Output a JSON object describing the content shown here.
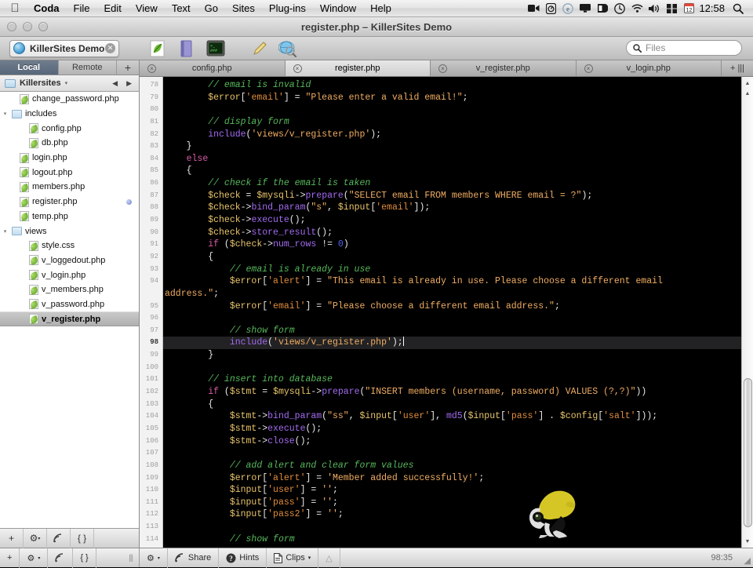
{
  "menubar": {
    "apple": "&#63743;",
    "items": [
      "Coda",
      "File",
      "Edit",
      "View",
      "Text",
      "Go",
      "Sites",
      "Plug-ins",
      "Window",
      "Help"
    ],
    "status_icons": [
      "screen-recording-icon",
      "dropbox-icon",
      "internet-explorer-icon",
      "display-icon",
      "dashboard-icon",
      "time-machine-icon",
      "wifi-icon",
      "volume-icon",
      "spaces-icon",
      "calendar-icon"
    ],
    "clock": "12:58",
    "spotlight": "search-icon"
  },
  "window": {
    "title": "register.php – KillerSites Demo",
    "traffic_lights": [
      "close",
      "minimize",
      "zoom"
    ]
  },
  "toolbar": {
    "site_tab_label": "KillerSites Demo",
    "icons": [
      "leaf-icon",
      "book-icon",
      "terminal-icon",
      "pencil-icon",
      "preview-icon"
    ],
    "search": {
      "placeholder": "Files",
      "value": ""
    }
  },
  "sidebar": {
    "tabs": [
      {
        "label": "Local",
        "active": true
      },
      {
        "label": "Remote",
        "active": false
      }
    ],
    "add_label": "+",
    "path": {
      "folder": "Killersites",
      "caret": "▾",
      "back": "◀",
      "forward": "▶"
    },
    "files": [
      {
        "name": "change_password.php",
        "type": "file",
        "indent": 1,
        "disclosure": "",
        "selected": false,
        "dot": false
      },
      {
        "name": "includes",
        "type": "folder",
        "indent": 0,
        "disclosure": "▾",
        "selected": false,
        "dot": false
      },
      {
        "name": "config.php",
        "type": "file",
        "indent": 2,
        "disclosure": "",
        "selected": false,
        "dot": false
      },
      {
        "name": "db.php",
        "type": "file",
        "indent": 2,
        "disclosure": "",
        "selected": false,
        "dot": false
      },
      {
        "name": "login.php",
        "type": "file",
        "indent": 1,
        "disclosure": "",
        "selected": false,
        "dot": false
      },
      {
        "name": "logout.php",
        "type": "file",
        "indent": 1,
        "disclosure": "",
        "selected": false,
        "dot": false
      },
      {
        "name": "members.php",
        "type": "file",
        "indent": 1,
        "disclosure": "",
        "selected": false,
        "dot": false
      },
      {
        "name": "register.php",
        "type": "file",
        "indent": 1,
        "disclosure": "",
        "selected": false,
        "dot": true
      },
      {
        "name": "temp.php",
        "type": "file",
        "indent": 1,
        "disclosure": "",
        "selected": false,
        "dot": false
      },
      {
        "name": "views",
        "type": "folder",
        "indent": 0,
        "disclosure": "▾",
        "selected": false,
        "dot": false
      },
      {
        "name": "style.css",
        "type": "file",
        "indent": 2,
        "disclosure": "",
        "selected": false,
        "dot": false
      },
      {
        "name": "v_loggedout.php",
        "type": "file",
        "indent": 2,
        "disclosure": "",
        "selected": false,
        "dot": false
      },
      {
        "name": "v_login.php",
        "type": "file",
        "indent": 2,
        "disclosure": "",
        "selected": false,
        "dot": false
      },
      {
        "name": "v_members.php",
        "type": "file",
        "indent": 2,
        "disclosure": "",
        "selected": false,
        "dot": false
      },
      {
        "name": "v_password.php",
        "type": "file",
        "indent": 2,
        "disclosure": "",
        "selected": false,
        "dot": false
      },
      {
        "name": "v_register.php",
        "type": "file",
        "indent": 2,
        "disclosure": "",
        "selected": true,
        "dot": false
      }
    ],
    "bottom_buttons": [
      "add-icon",
      "gear-icon",
      "publish-icon",
      "braces-icon"
    ]
  },
  "editor": {
    "tabs": [
      {
        "label": "config.php",
        "active": false
      },
      {
        "label": "register.php",
        "active": true
      },
      {
        "label": "v_register.php",
        "active": false
      },
      {
        "label": "v_login.php",
        "active": false
      }
    ],
    "tab_end": "+ |||",
    "first_line": 78,
    "cursor_line": 98,
    "lines": [
      {
        "n": 78,
        "indent": 8,
        "tokens": [
          [
            "com",
            "// email is invalid"
          ]
        ]
      },
      {
        "n": 79,
        "indent": 8,
        "tokens": [
          [
            "var",
            "$error"
          ],
          [
            "pl",
            "["
          ],
          [
            "idx",
            "'email'"
          ],
          [
            "pl",
            "] = "
          ],
          [
            "str",
            "\"Please enter a valid email!\""
          ],
          [
            "pl",
            ";"
          ]
        ]
      },
      {
        "n": 80,
        "indent": 0,
        "tokens": []
      },
      {
        "n": 81,
        "indent": 8,
        "tokens": [
          [
            "com",
            "// display form"
          ]
        ]
      },
      {
        "n": 82,
        "indent": 8,
        "tokens": [
          [
            "fn",
            "include"
          ],
          [
            "pl",
            "("
          ],
          [
            "str",
            "'views/v_register.php'"
          ],
          [
            "pl",
            ");"
          ]
        ]
      },
      {
        "n": 83,
        "indent": 4,
        "tokens": [
          [
            "pl",
            "}"
          ]
        ]
      },
      {
        "n": 84,
        "indent": 4,
        "tokens": [
          [
            "key",
            "else"
          ]
        ]
      },
      {
        "n": 85,
        "indent": 4,
        "tokens": [
          [
            "pl",
            "{"
          ]
        ]
      },
      {
        "n": 86,
        "indent": 8,
        "tokens": [
          [
            "com",
            "// check if the email is taken"
          ]
        ]
      },
      {
        "n": 87,
        "indent": 8,
        "tokens": [
          [
            "var",
            "$check"
          ],
          [
            "pl",
            " = "
          ],
          [
            "var",
            "$mysqli"
          ],
          [
            "pl",
            "->"
          ],
          [
            "fn",
            "prepare"
          ],
          [
            "pl",
            "("
          ],
          [
            "str",
            "\"SELECT email FROM members WHERE email = ?\""
          ],
          [
            "pl",
            ");"
          ]
        ]
      },
      {
        "n": 88,
        "indent": 8,
        "tokens": [
          [
            "var",
            "$check"
          ],
          [
            "pl",
            "->"
          ],
          [
            "fn",
            "bind_param"
          ],
          [
            "pl",
            "("
          ],
          [
            "str",
            "\"s\""
          ],
          [
            "pl",
            ", "
          ],
          [
            "var",
            "$input"
          ],
          [
            "pl",
            "["
          ],
          [
            "idx",
            "'email'"
          ],
          [
            "pl",
            "]);"
          ]
        ]
      },
      {
        "n": 89,
        "indent": 8,
        "tokens": [
          [
            "var",
            "$check"
          ],
          [
            "pl",
            "->"
          ],
          [
            "fn",
            "execute"
          ],
          [
            "pl",
            "();"
          ]
        ]
      },
      {
        "n": 90,
        "indent": 8,
        "tokens": [
          [
            "var",
            "$check"
          ],
          [
            "pl",
            "->"
          ],
          [
            "fn",
            "store_result"
          ],
          [
            "pl",
            "();"
          ]
        ]
      },
      {
        "n": 91,
        "indent": 8,
        "tokens": [
          [
            "key",
            "if"
          ],
          [
            "pl",
            " ("
          ],
          [
            "var",
            "$check"
          ],
          [
            "pl",
            "->"
          ],
          [
            "fn",
            "num_rows"
          ],
          [
            "pl",
            " != "
          ],
          [
            "num",
            "0"
          ],
          [
            "pl",
            ")"
          ]
        ]
      },
      {
        "n": 92,
        "indent": 8,
        "tokens": [
          [
            "pl",
            "{"
          ]
        ]
      },
      {
        "n": 93,
        "indent": 12,
        "tokens": [
          [
            "com",
            "// email is already in use"
          ]
        ]
      },
      {
        "n": 94,
        "indent": 12,
        "tokens": [
          [
            "var",
            "$error"
          ],
          [
            "pl",
            "["
          ],
          [
            "idx",
            "'alert'"
          ],
          [
            "pl",
            "] = "
          ],
          [
            "str",
            "\"This email is already in use. Please choose a different email"
          ]
        ],
        "wrap": [
          [
            "str",
            "address.\""
          ],
          [
            "pl",
            ";"
          ]
        ]
      },
      {
        "n": 95,
        "indent": 12,
        "tokens": [
          [
            "var",
            "$error"
          ],
          [
            "pl",
            "["
          ],
          [
            "idx",
            "'email'"
          ],
          [
            "pl",
            "] = "
          ],
          [
            "str",
            "\"Please choose a different email address.\""
          ],
          [
            "pl",
            ";"
          ]
        ]
      },
      {
        "n": 96,
        "indent": 0,
        "tokens": []
      },
      {
        "n": 97,
        "indent": 12,
        "tokens": [
          [
            "com",
            "// show form"
          ]
        ]
      },
      {
        "n": 98,
        "indent": 12,
        "tokens": [
          [
            "fn",
            "include"
          ],
          [
            "pl",
            "("
          ],
          [
            "str",
            "'views/v_register.php'"
          ],
          [
            "pl",
            ");"
          ]
        ],
        "highlight": true
      },
      {
        "n": 99,
        "indent": 8,
        "tokens": [
          [
            "pl",
            "}"
          ]
        ]
      },
      {
        "n": 100,
        "indent": 0,
        "tokens": []
      },
      {
        "n": 101,
        "indent": 8,
        "tokens": [
          [
            "com",
            "// insert into database"
          ]
        ]
      },
      {
        "n": 102,
        "indent": 8,
        "tokens": [
          [
            "key",
            "if"
          ],
          [
            "pl",
            " ("
          ],
          [
            "var",
            "$stmt"
          ],
          [
            "pl",
            " = "
          ],
          [
            "var",
            "$mysqli"
          ],
          [
            "pl",
            "->"
          ],
          [
            "fn",
            "prepare"
          ],
          [
            "pl",
            "("
          ],
          [
            "str",
            "\"INSERT members (username, password) VALUES (?,?)\""
          ],
          [
            "pl",
            "))"
          ]
        ]
      },
      {
        "n": 103,
        "indent": 8,
        "tokens": [
          [
            "pl",
            "{"
          ]
        ]
      },
      {
        "n": 104,
        "indent": 12,
        "tokens": [
          [
            "var",
            "$stmt"
          ],
          [
            "pl",
            "->"
          ],
          [
            "fn",
            "bind_param"
          ],
          [
            "pl",
            "("
          ],
          [
            "str",
            "\"ss\""
          ],
          [
            "pl",
            ", "
          ],
          [
            "var",
            "$input"
          ],
          [
            "pl",
            "["
          ],
          [
            "idx",
            "'user'"
          ],
          [
            "pl",
            "], "
          ],
          [
            "fn",
            "md5"
          ],
          [
            "pl",
            "("
          ],
          [
            "var",
            "$input"
          ],
          [
            "pl",
            "["
          ],
          [
            "idx",
            "'pass'"
          ],
          [
            "pl",
            "] . "
          ],
          [
            "var",
            "$config"
          ],
          [
            "pl",
            "["
          ],
          [
            "idx",
            "'salt'"
          ],
          [
            "pl",
            "]));"
          ]
        ]
      },
      {
        "n": 105,
        "indent": 12,
        "tokens": [
          [
            "var",
            "$stmt"
          ],
          [
            "pl",
            "->"
          ],
          [
            "fn",
            "execute"
          ],
          [
            "pl",
            "();"
          ]
        ]
      },
      {
        "n": 106,
        "indent": 12,
        "tokens": [
          [
            "var",
            "$stmt"
          ],
          [
            "pl",
            "->"
          ],
          [
            "fn",
            "close"
          ],
          [
            "pl",
            "();"
          ]
        ]
      },
      {
        "n": 107,
        "indent": 0,
        "tokens": []
      },
      {
        "n": 108,
        "indent": 12,
        "tokens": [
          [
            "com",
            "// add alert and clear form values"
          ]
        ]
      },
      {
        "n": 109,
        "indent": 12,
        "tokens": [
          [
            "var",
            "$error"
          ],
          [
            "pl",
            "["
          ],
          [
            "idx",
            "'alert'"
          ],
          [
            "pl",
            "] = "
          ],
          [
            "str",
            "'Member added successfully!'"
          ],
          [
            "pl",
            ";"
          ]
        ]
      },
      {
        "n": 110,
        "indent": 12,
        "tokens": [
          [
            "var",
            "$input"
          ],
          [
            "pl",
            "["
          ],
          [
            "idx",
            "'user'"
          ],
          [
            "pl",
            "] = "
          ],
          [
            "str",
            "''"
          ],
          [
            "pl",
            ";"
          ]
        ]
      },
      {
        "n": 111,
        "indent": 12,
        "tokens": [
          [
            "var",
            "$input"
          ],
          [
            "pl",
            "["
          ],
          [
            "idx",
            "'pass'"
          ],
          [
            "pl",
            "] = "
          ],
          [
            "str",
            "''"
          ],
          [
            "pl",
            ";"
          ]
        ]
      },
      {
        "n": 112,
        "indent": 12,
        "tokens": [
          [
            "var",
            "$input"
          ],
          [
            "pl",
            "["
          ],
          [
            "idx",
            "'pass2'"
          ],
          [
            "pl",
            "] = "
          ],
          [
            "str",
            "''"
          ],
          [
            "pl",
            ";"
          ]
        ]
      },
      {
        "n": 113,
        "indent": 0,
        "tokens": []
      },
      {
        "n": 114,
        "indent": 12,
        "tokens": [
          [
            "com",
            "// show form"
          ]
        ]
      }
    ],
    "watermark": "frog-icon"
  },
  "statusbar": {
    "left_buttons": [
      "add-icon",
      "gear-icon",
      "publish-icon",
      "braces-icon"
    ],
    "grip": "|||",
    "buttons": [
      {
        "label": "",
        "icon": "gear-icon",
        "dim": false
      },
      {
        "label": "Share",
        "icon": "share-icon",
        "dim": false
      },
      {
        "label": "Hints",
        "icon": "hints-icon",
        "dim": false
      },
      {
        "label": "Clips",
        "icon": "clips-icon",
        "dim": false
      },
      {
        "label": "",
        "icon": "warning-icon",
        "dim": true
      }
    ],
    "line_col": "98:35",
    "resize": "resize-grip-icon"
  },
  "colors": {
    "comment": "#57b85b",
    "variable": "#e8c46a",
    "keyword": "#d95ba8",
    "function": "#a36bf0",
    "string": "#f0ad62",
    "number": "#4f63ef",
    "editor_bg": "#000000",
    "highlight_row": "#222224"
  }
}
